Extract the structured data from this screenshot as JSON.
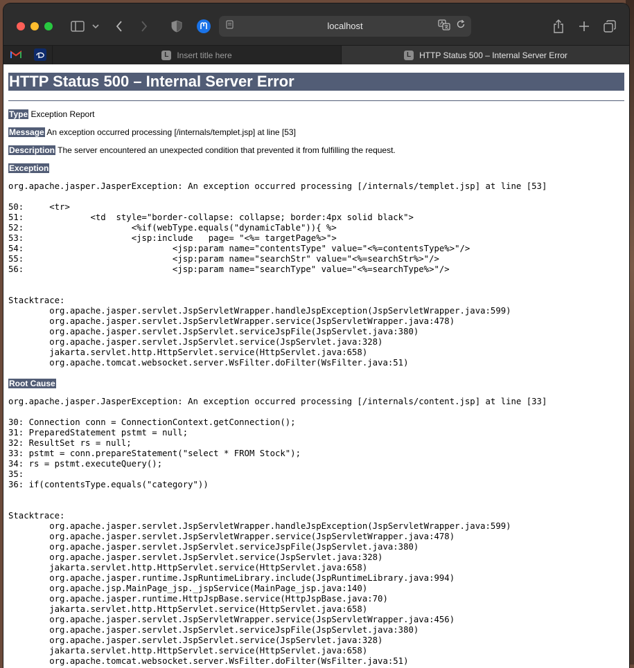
{
  "browser": {
    "address": "localhost",
    "tabs": [
      {
        "label": "Insert title here",
        "favicon": "L"
      },
      {
        "label": "HTTP Status 500 – Internal Server Error",
        "favicon": "L"
      }
    ]
  },
  "page": {
    "title": "HTTP Status 500 – Internal Server Error",
    "type_label": "Type",
    "type_value": "Exception Report",
    "message_label": "Message",
    "message_value": "An exception occurred processing [/internals/templet.jsp] at line [53]",
    "description_label": "Description",
    "description_value": "The server encountered an unexpected condition that prevented it from fulfilling the request.",
    "exception_label": "Exception",
    "exception_text": "org.apache.jasper.JasperException: An exception occurred processing [/internals/templet.jsp] at line [53]\n\n50:\t<tr>\n51:\t\t<td  style=\"border-collapse: collapse; border:4px solid black\">\n52:\t\t\t<%if(webType.equals(\"dynamicTable\")){ %>\n53:\t\t\t<jsp:include   page= \"<%= targetPage%>\">\n54:\t\t\t\t<jsp:param name=\"contentsType\" value=\"<%=contentsType%>\"/>\n55:\t\t\t\t<jsp:param name=\"searchStr\" value=\"<%=searchStr%>\"/>\n56:\t\t\t\t<jsp:param name=\"searchType\" value=\"<%=searchType%>\"/>\n\n\nStacktrace:\n\torg.apache.jasper.servlet.JspServletWrapper.handleJspException(JspServletWrapper.java:599)\n\torg.apache.jasper.servlet.JspServletWrapper.service(JspServletWrapper.java:478)\n\torg.apache.jasper.servlet.JspServlet.serviceJspFile(JspServlet.java:380)\n\torg.apache.jasper.servlet.JspServlet.service(JspServlet.java:328)\n\tjakarta.servlet.http.HttpServlet.service(HttpServlet.java:658)\n\torg.apache.tomcat.websocket.server.WsFilter.doFilter(WsFilter.java:51)",
    "root_cause_label": "Root Cause",
    "root_cause_text": "org.apache.jasper.JasperException: An exception occurred processing [/internals/content.jsp] at line [33]\n\n30: Connection conn = ConnectionContext.getConnection();\n31: PreparedStatement pstmt = null;\n32: ResultSet rs = null;\n33: pstmt = conn.prepareStatement(\"select * FROM Stock\");\n34: rs = pstmt.executeQuery();\n35: \n36: if(contentsType.equals(\"category\"))\n\n\nStacktrace:\n\torg.apache.jasper.servlet.JspServletWrapper.handleJspException(JspServletWrapper.java:599)\n\torg.apache.jasper.servlet.JspServletWrapper.service(JspServletWrapper.java:478)\n\torg.apache.jasper.servlet.JspServlet.serviceJspFile(JspServlet.java:380)\n\torg.apache.jasper.servlet.JspServlet.service(JspServlet.java:328)\n\tjakarta.servlet.http.HttpServlet.service(HttpServlet.java:658)\n\torg.apache.jasper.runtime.JspRuntimeLibrary.include(JspRuntimeLibrary.java:994)\n\torg.apache.jsp.MainPage_jsp._jspService(MainPage_jsp.java:140)\n\torg.apache.jasper.runtime.HttpJspBase.service(HttpJspBase.java:70)\n\tjakarta.servlet.http.HttpServlet.service(HttpServlet.java:658)\n\torg.apache.jasper.servlet.JspServletWrapper.service(JspServletWrapper.java:456)\n\torg.apache.jasper.servlet.JspServlet.serviceJspFile(JspServlet.java:380)\n\torg.apache.jasper.servlet.JspServlet.service(JspServlet.java:328)\n\tjakarta.servlet.http.HttpServlet.service(HttpServlet.java:658)\n\torg.apache.tomcat.websocket.server.WsFilter.doFilter(WsFilter.java:51)"
  },
  "colors": {
    "header_bg": "#525d76",
    "header_fg": "#ffffff"
  }
}
